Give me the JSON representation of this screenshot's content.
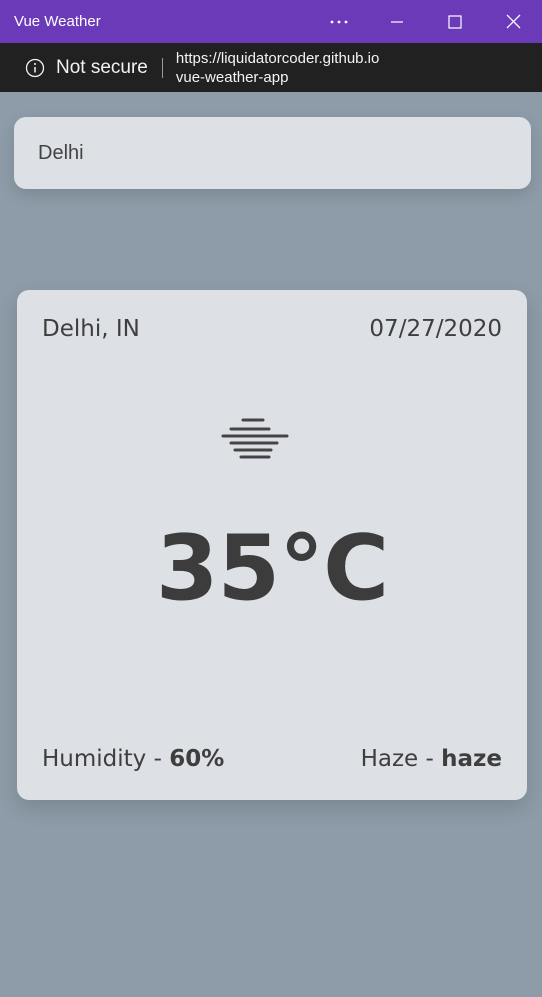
{
  "window": {
    "title": "Vue Weather",
    "more_icon": "ellipsis-icon",
    "minimize_icon": "minimize-icon",
    "maximize_icon": "maximize-icon",
    "close_icon": "close-icon",
    "titlebar_color": "#6a3ab8"
  },
  "browser": {
    "security_icon": "info-icon",
    "security_label": "Not secure",
    "url_line1": "https://liquidatorcoder.github.io",
    "url_line2": "vue-weather-app"
  },
  "search": {
    "value": "Delhi"
  },
  "weather": {
    "location": "Delhi, IN",
    "date": "07/27/2020",
    "icon": "haze-icon",
    "temperature": "35°C",
    "humidity_label": "Humidity - ",
    "humidity_value": "60%",
    "condition_label": "Haze - ",
    "condition_value": "haze"
  },
  "colors": {
    "background": "#8d9ca8",
    "card": "#dde1e5",
    "text": "#3e3e3e"
  }
}
